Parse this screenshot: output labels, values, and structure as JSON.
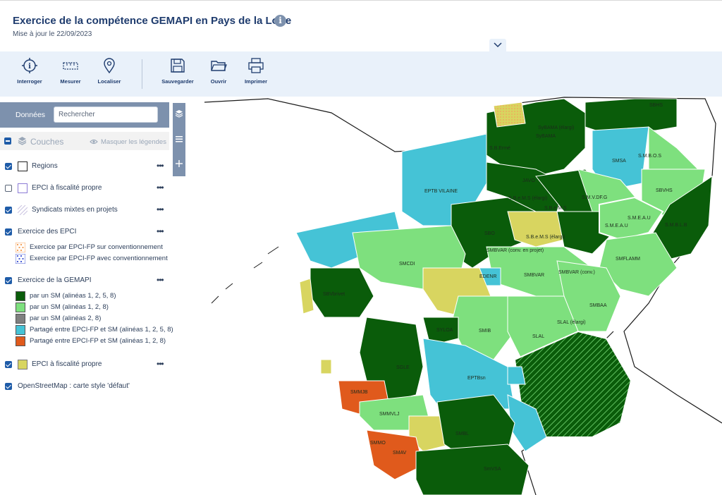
{
  "header": {
    "title": "Exercice de la compétence GEMAPI en Pays de la Loire",
    "info_icon": "info-icon",
    "subtitle": "Mise à jour le 22/09/2023",
    "collapse_icon": "chevron-down-icon"
  },
  "toolbar": {
    "tools": [
      {
        "label": "Interroger",
        "icon": "query-info-icon"
      },
      {
        "label": "Mesurer",
        "icon": "ruler-icon"
      },
      {
        "label": "Localiser",
        "icon": "map-pin-icon"
      },
      {
        "label": "Sauvegarder",
        "icon": "floppy-disk-icon"
      },
      {
        "label": "Ouvrir",
        "icon": "folder-icon"
      },
      {
        "label": "Imprimer",
        "icon": "printer-icon"
      }
    ]
  },
  "panel": {
    "tab_label": "Données",
    "search_placeholder": "Rechercher",
    "layers_title": "Couches",
    "hide_legends": "Masquer les légendes",
    "side_icons": [
      "layers-icon",
      "list-icon",
      "plus-icon"
    ],
    "layers": [
      {
        "label": "Regions",
        "checked": true
      },
      {
        "label": "EPCI à fiscalité propre",
        "checked": false
      },
      {
        "label": "Syndicats mixtes en projets",
        "checked": true
      },
      {
        "label": "Exercice des EPCI",
        "checked": true,
        "legend": [
          {
            "label": "Exercice par EPCI-FP sur conventionnement",
            "color": "#f4a25a"
          },
          {
            "label": "Exercice par EPCI-FP avec conventionnement",
            "color": "#4b5fd6"
          }
        ]
      },
      {
        "label": "Exercice de la GEMAPI",
        "checked": true,
        "legend": [
          {
            "label": "par un SM (alinéas 1, 2, 5, 8)",
            "color": "#0a5c0a"
          },
          {
            "label": "par un SM (alinéas 1, 2, 8)",
            "color": "#7ee07e"
          },
          {
            "label": "par un SM (alinéas 2, 8)",
            "color": "#808080"
          },
          {
            "label": "Partagé entre EPCI-FP et SM (alinéas 1, 2, 5, 8)",
            "color": "#45c3d6"
          },
          {
            "label": "Partagé entre EPCI-FP et SM (alinéas 1, 2, 8)",
            "color": "#e05a1c"
          }
        ]
      },
      {
        "label": "EPCI à fiscalité propre",
        "checked": true,
        "color": "#d8d560"
      },
      {
        "label": "OpenStreetMap : carte style 'défaut'",
        "checked": true
      }
    ],
    "dots": "•••"
  },
  "map": {
    "labels": [
      "SBHS",
      "SyBAMA (élargi)",
      "SyBAMA",
      "S.B.Ermé",
      "S.M.B.O.S",
      "SMSA",
      "JAVO",
      "EPTB VILAINE",
      "SBVHS",
      "S.M.V.DF.G",
      "S.B.e.M.S (élargi)",
      "S.B.e.M.S",
      "SBO",
      "S.B.e.M.S (élargi)",
      "SMBVAR (conv. en projet)",
      "S.M.B.L.B",
      "SMCDI",
      "SMBVAR",
      "SMBVAR (conv.)",
      "SMFLAMM",
      "EDENR",
      "SBVbrivet",
      "SMBAA",
      "SMIB",
      "SLAL",
      "SLAL (élargi)",
      "SYLOA",
      "SGLE",
      "EPTBsn",
      "SMMJB",
      "SMMVLJ",
      "SMBL",
      "SMMO",
      "SMAV",
      "SmVSA",
      "S.M.E.A.U",
      "S.M.E.A.U"
    ]
  }
}
